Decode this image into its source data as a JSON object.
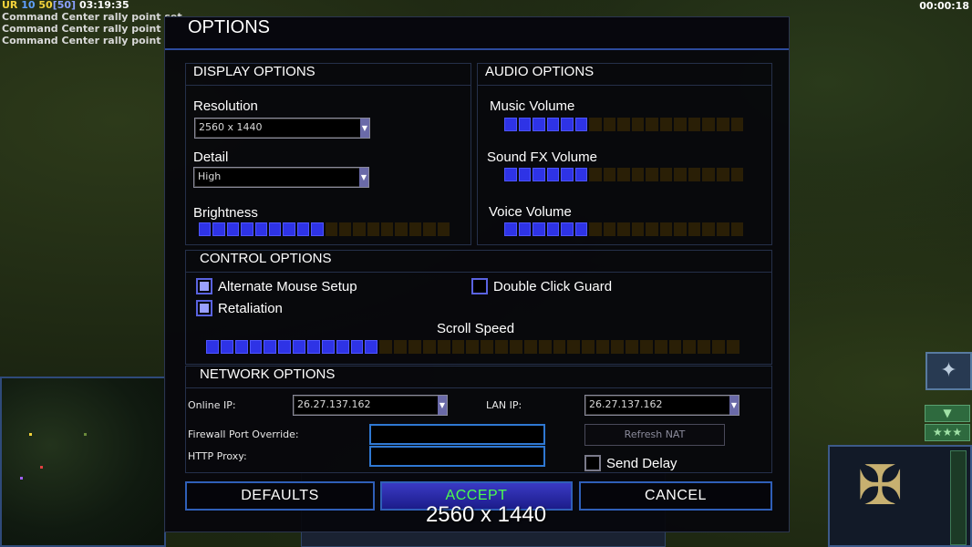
{
  "hud": {
    "rank": "UR",
    "level": "10",
    "money": "50",
    "capacity": "[50]",
    "clock": "03:19:35",
    "timer": "00:00:18",
    "messages": [
      "Command Center rally point set",
      "Command Center rally point set",
      "Command Center rally point set"
    ]
  },
  "dialog": {
    "title": "OPTIONS",
    "display": {
      "title": "DISPLAY OPTIONS",
      "resolution_label": "Resolution",
      "resolution_value": "2560 x 1440",
      "detail_label": "Detail",
      "detail_value": "High",
      "brightness_label": "Brightness",
      "brightness_level": 0.5
    },
    "audio": {
      "title": "AUDIO OPTIONS",
      "music_label": "Music Volume",
      "music_level": 0.35,
      "sfx_label": "Sound FX Volume",
      "sfx_level": 0.35,
      "voice_label": "Voice Volume",
      "voice_level": 0.35
    },
    "control": {
      "title": "CONTROL OPTIONS",
      "alt_mouse_label": "Alternate Mouse Setup",
      "alt_mouse_checked": true,
      "retaliation_label": "Retaliation",
      "retaliation_checked": true,
      "double_click_label": "Double Click Guard",
      "double_click_checked": false,
      "scroll_label": "Scroll Speed",
      "scroll_level": 0.32
    },
    "network": {
      "title": "NETWORK OPTIONS",
      "online_ip_label": "Online IP:",
      "online_ip_value": "26.27.137.162",
      "lan_ip_label": "LAN IP:",
      "lan_ip_value": "26.27.137.162",
      "firewall_label": "Firewall Port Override:",
      "firewall_value": "",
      "http_proxy_label": "HTTP Proxy:",
      "http_proxy_value": "",
      "refresh_nat_label": "Refresh NAT",
      "send_delay_label": "Send Delay",
      "send_delay_checked": false
    },
    "buttons": {
      "defaults": "DEFAULTS",
      "accept": "ACCEPT",
      "cancel": "CANCEL"
    },
    "tooltip": "2560 x 1440"
  },
  "colors": {
    "slider_on": "#2e33e6",
    "slider_off": "#2a1f06",
    "accent_border": "#2c4a9c",
    "accept_text": "#4dff4d"
  }
}
